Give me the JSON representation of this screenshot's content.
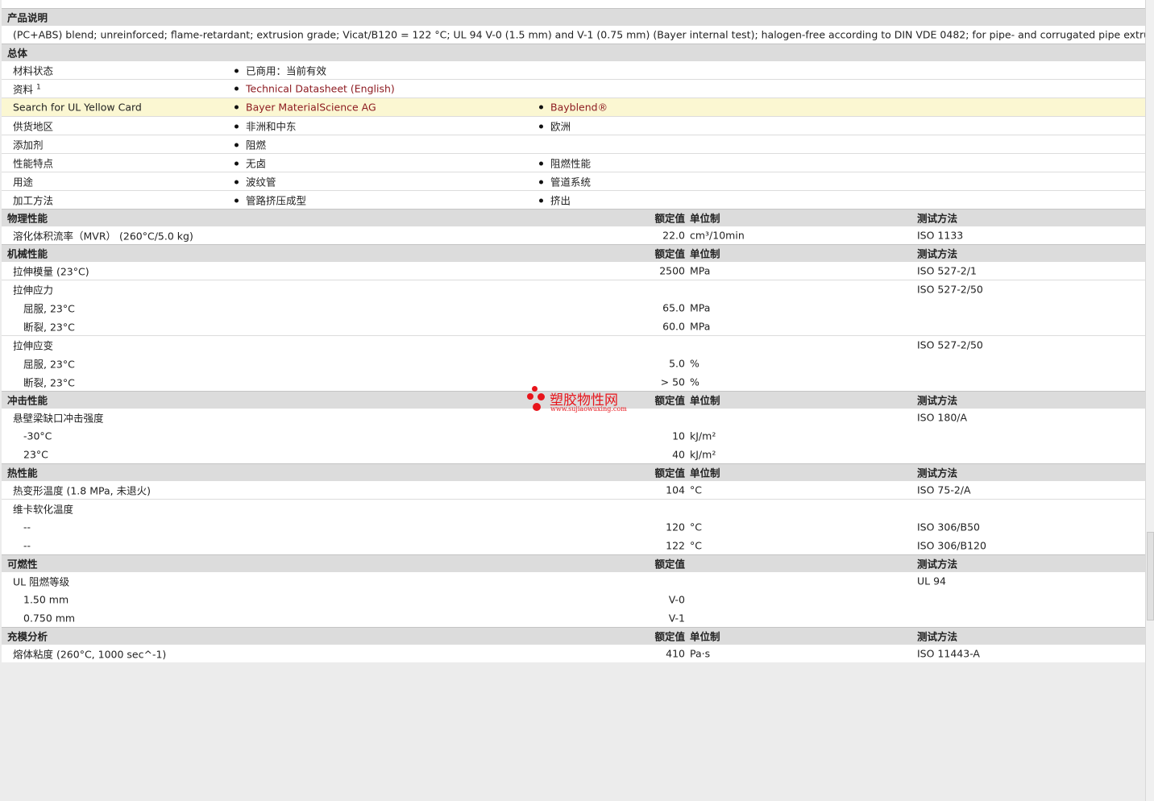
{
  "sections": {
    "description": {
      "title": "产品说明",
      "text": "(PC+ABS) blend; unreinforced; flame-retardant; extrusion grade; Vicat/B120 = 122 °C; UL 94 V-0 (1.5 mm) and V-1 (0.75 mm) (Bayer internal test); halogen-free according to DIN VDE 0482; for pipe- and corrugated pipe extrusion."
    },
    "general": {
      "title": "总体",
      "rows": [
        {
          "label": "材料状态",
          "v1": "已商用：当前有效",
          "v2": ""
        },
        {
          "label": "资料",
          "sup": "1",
          "v1": "Technical Datasheet (English)",
          "v2": ""
        },
        {
          "label": "Search for UL Yellow Card",
          "v1": "Bayer MaterialScience AG",
          "v2": "Bayblend®"
        },
        {
          "label": "供货地区",
          "v1": "非洲和中东",
          "v2": "欧洲"
        },
        {
          "label": "添加剂",
          "v1": "阻燃",
          "v2": ""
        },
        {
          "label": "性能特点",
          "v1": "无卤",
          "v2": "阻燃性能"
        },
        {
          "label": "用途",
          "v1": "波纹管",
          "v2": "管道系统"
        },
        {
          "label": "加工方法",
          "v1": "管路挤压成型",
          "v2": "挤出"
        }
      ]
    },
    "headers": {
      "value": "额定值",
      "unit": "单位制",
      "test": "测试方法"
    },
    "physical": {
      "title": "物理性能",
      "rows": [
        {
          "label": "溶化体积流率（MVR） (260°C/5.0 kg)",
          "value": "22.0",
          "unit": "cm³/10min",
          "test": "ISO 1133"
        }
      ]
    },
    "mechanical": {
      "title": "机械性能",
      "rows": [
        {
          "label": "拉伸模量 (23°C)",
          "value": "2500",
          "unit": "MPa",
          "test": "ISO 527-2/1"
        },
        {
          "label": "拉伸应力",
          "value": "",
          "unit": "",
          "test": "ISO 527-2/50"
        },
        {
          "label": "屈服, 23°C",
          "value": "65.0",
          "unit": "MPa",
          "test": ""
        },
        {
          "label": "断裂, 23°C",
          "value": "60.0",
          "unit": "MPa",
          "test": ""
        },
        {
          "label": "拉伸应变",
          "value": "",
          "unit": "",
          "test": "ISO 527-2/50"
        },
        {
          "label": "屈服, 23°C",
          "value": "5.0",
          "unit": "%",
          "test": ""
        },
        {
          "label": "断裂, 23°C",
          "value": "> 50",
          "unit": "%",
          "test": ""
        }
      ]
    },
    "impact": {
      "title": "冲击性能",
      "rows": [
        {
          "label": "悬壁梁缺口冲击强度",
          "value": "",
          "unit": "",
          "test": "ISO 180/A"
        },
        {
          "label": "-30°C",
          "value": "10",
          "unit": "kJ/m²",
          "test": ""
        },
        {
          "label": "23°C",
          "value": "40",
          "unit": "kJ/m²",
          "test": ""
        }
      ]
    },
    "thermal": {
      "title": "热性能",
      "rows": [
        {
          "label": "热变形温度 (1.8 MPa, 未退火)",
          "value": "104",
          "unit": "°C",
          "test": "ISO 75-2/A"
        },
        {
          "label": "维卡软化温度",
          "value": "",
          "unit": "",
          "test": ""
        },
        {
          "label": "--",
          "value": "120",
          "unit": "°C",
          "test": "ISO 306/B50"
        },
        {
          "label": "--",
          "value": "122",
          "unit": "°C",
          "test": "ISO 306/B120"
        }
      ]
    },
    "flammability": {
      "title": "可燃性",
      "rows": [
        {
          "label": "UL 阻燃等级",
          "value": "",
          "unit": "",
          "test": "UL 94"
        },
        {
          "label": "1.50 mm",
          "value": "V-0",
          "unit": "",
          "test": ""
        },
        {
          "label": "0.750 mm",
          "value": "V-1",
          "unit": "",
          "test": ""
        }
      ]
    },
    "mold": {
      "title": "充模分析",
      "rows": [
        {
          "label": "熔体粘度 (260°C, 1000 sec^-1)",
          "value": "410",
          "unit": "Pa·s",
          "test": "ISO 11443-A"
        }
      ]
    }
  },
  "watermark": {
    "name": "塑胶物性网",
    "url": "www.sujiaowuxing.com"
  },
  "colors": {
    "link": "#8e1c22",
    "highlight": "#fbf7d2",
    "section_bg": "#dcdcdc",
    "watermark": "#e8141b"
  }
}
